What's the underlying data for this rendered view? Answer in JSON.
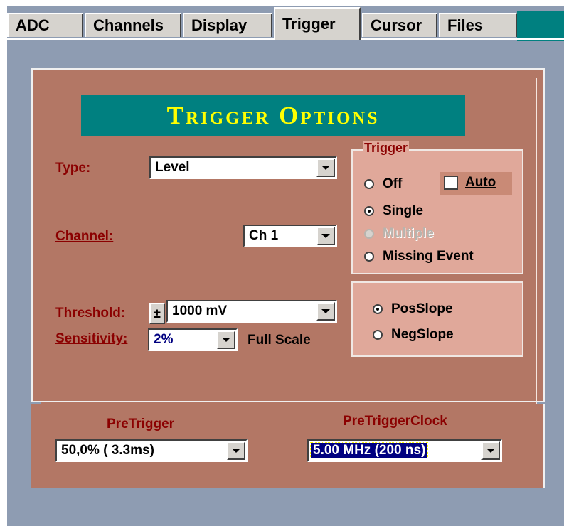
{
  "tabs": [
    {
      "label": "ADC"
    },
    {
      "label": "Channels"
    },
    {
      "label": "Display"
    },
    {
      "label": "Trigger"
    },
    {
      "label": "Cursor"
    },
    {
      "label": "Files"
    }
  ],
  "active_tab": "Trigger",
  "title": "Trigger Options",
  "type": {
    "label": "Type:",
    "value": "Level"
  },
  "channel": {
    "label": "Channel:",
    "value": "Ch 1"
  },
  "threshold": {
    "label": "Threshold:",
    "sign": "±",
    "value": "1000 mV"
  },
  "sensitivity": {
    "label": "Sensitivity:",
    "value": "2%",
    "suffix": "Full Scale"
  },
  "trigger_group": {
    "title": "Trigger",
    "options": [
      "Off",
      "Single",
      "Multiple",
      "Missing Event"
    ],
    "selected": "Single",
    "disabled": [
      "Multiple"
    ],
    "auto_label": "Auto",
    "auto_checked": false
  },
  "slope_group": {
    "options": [
      "PosSlope",
      "NegSlope"
    ],
    "selected": "PosSlope"
  },
  "pretrigger": {
    "label": "PreTrigger",
    "value": "50,0% ( 3.3ms)"
  },
  "pretrigger_clock": {
    "label": "PreTriggerClock",
    "value": "5.00 MHz (200 ns)"
  },
  "colors": {
    "panel": "#b37765",
    "group": "#e0a89a",
    "title_bg": "#008080",
    "title_fg": "#ffff00",
    "label": "#8b0000",
    "background": "#8e9cb2"
  }
}
